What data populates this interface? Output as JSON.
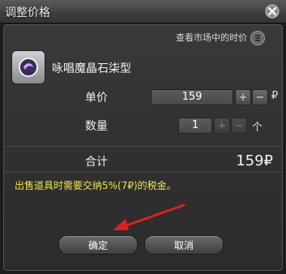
{
  "window": {
    "title": "调整价格"
  },
  "market": {
    "link_text": "查看市场中的时价",
    "icon": "list-icon"
  },
  "item": {
    "name": "咏唱魔晶石柒型",
    "icon": "materia-icon"
  },
  "price": {
    "label": "单价",
    "value": "159",
    "plus": "+",
    "minus": "−",
    "unit": "₽"
  },
  "quantity": {
    "label": "数量",
    "value": "1",
    "plus": "+",
    "minus": "−",
    "unit": "个"
  },
  "total": {
    "label": "合计",
    "value": "159₽"
  },
  "notice": "出售道具时需要交纳5%(7₽)的税金。",
  "buttons": {
    "confirm": "确定",
    "cancel": "取消"
  },
  "colors": {
    "notice": "#f2e34a",
    "arrow": "#e02020"
  }
}
